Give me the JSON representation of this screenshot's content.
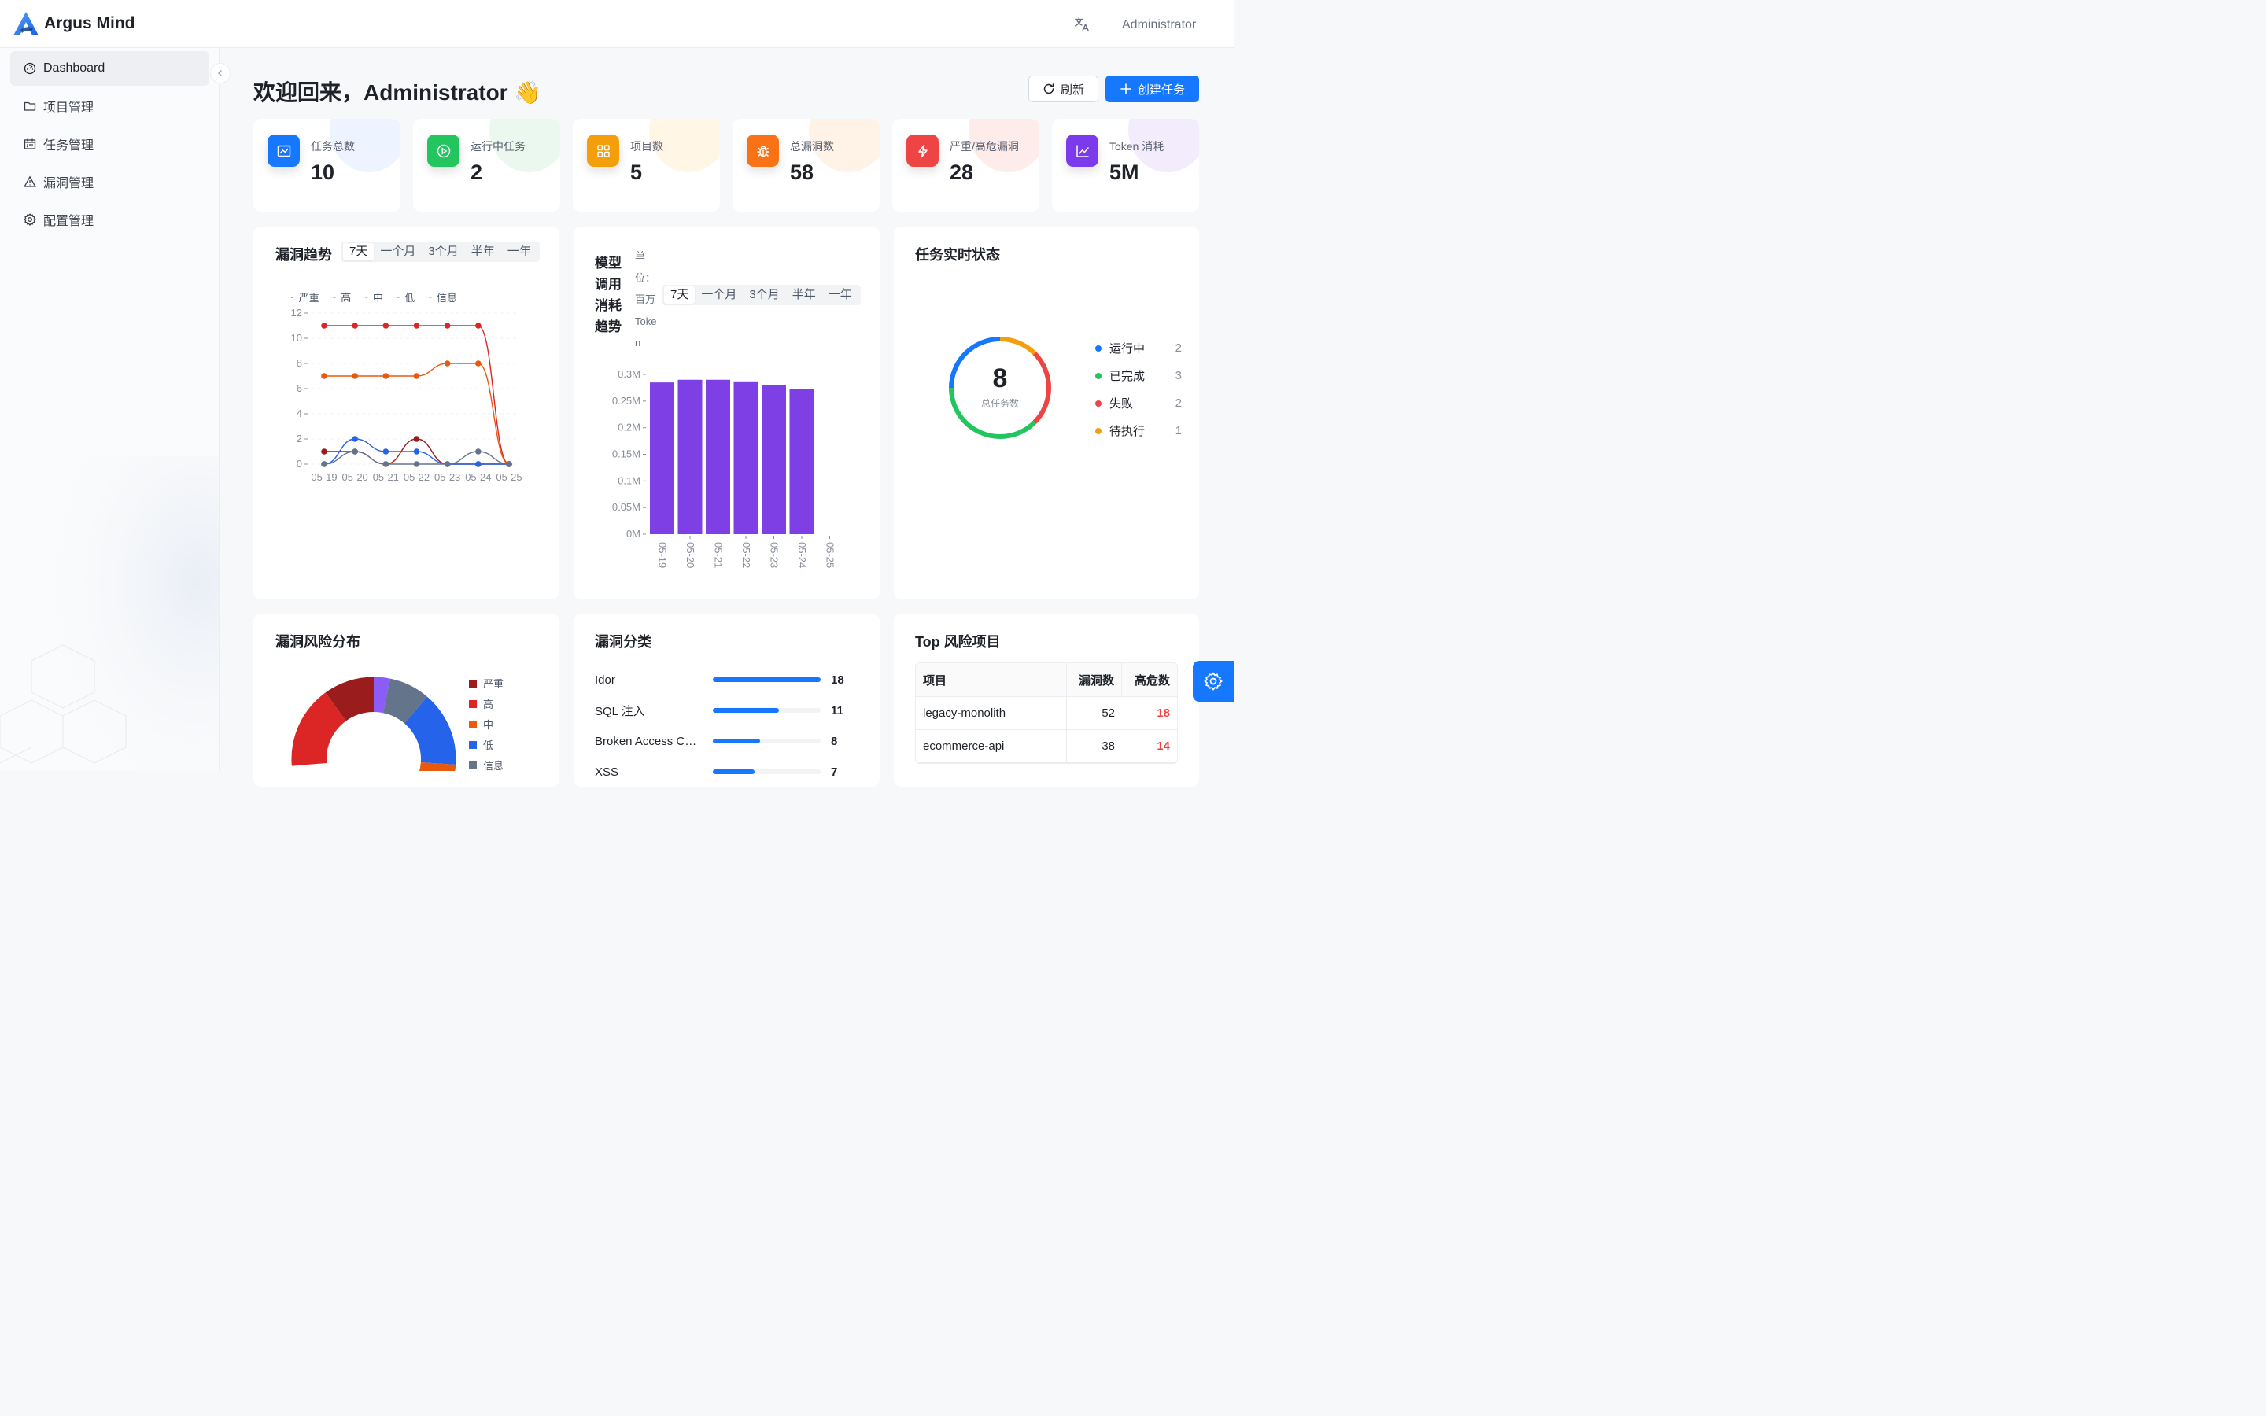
{
  "brand": {
    "name": "Argus Mind",
    "logo_icon": "argus-a-logo"
  },
  "header": {
    "user": "Administrator",
    "translate_icon": "translate-icon"
  },
  "sidebar": {
    "items": [
      {
        "label": "Dashboard",
        "icon": "dashboard-icon",
        "active": true
      },
      {
        "label": "项目管理",
        "icon": "folder-icon"
      },
      {
        "label": "任务管理",
        "icon": "calendar-icon"
      },
      {
        "label": "漏洞管理",
        "icon": "warning-icon"
      },
      {
        "label": "配置管理",
        "icon": "gear-icon"
      }
    ]
  },
  "welcome": {
    "title": "欢迎回来，Administrator 👋",
    "refresh_label": "刷新",
    "create_label": "创建任务"
  },
  "stats": [
    {
      "label": "任务总数",
      "value": "10",
      "color": "#1677ff"
    },
    {
      "label": "运行中任务",
      "value": "2",
      "color": "#22c55e"
    },
    {
      "label": "项目数",
      "value": "5",
      "color": "#f59e0b"
    },
    {
      "label": "总漏洞数",
      "value": "58",
      "color": "#f97316"
    },
    {
      "label": "严重/高危漏洞",
      "value": "28",
      "color": "#ef4444"
    },
    {
      "label": "Token 消耗",
      "value": "5M",
      "color": "#7c3aed"
    }
  ],
  "ranges": [
    "7天",
    "一个月",
    "3个月",
    "半年",
    "一年"
  ],
  "vuln_trend": {
    "title": "漏洞趋势",
    "chart_data": {
      "type": "line",
      "x": [
        "05-19",
        "05-20",
        "05-21",
        "05-22",
        "05-23",
        "05-24",
        "05-25"
      ],
      "ylim": [
        0,
        12
      ],
      "yticks": [
        "0",
        "2",
        "4",
        "6",
        "8",
        "10",
        "12"
      ],
      "series": [
        {
          "name": "严重",
          "color": "#9b1c1c",
          "values": [
            1,
            1,
            0,
            2,
            0,
            0,
            0
          ]
        },
        {
          "name": "高",
          "color": "#dc2626",
          "values": [
            11,
            11,
            11,
            11,
            11,
            11,
            0
          ]
        },
        {
          "name": "中",
          "color": "#ea580c",
          "values": [
            7,
            7,
            7,
            7,
            8,
            8,
            0
          ]
        },
        {
          "name": "低",
          "color": "#2563eb",
          "values": [
            0,
            2,
            1,
            1,
            0,
            0,
            0
          ]
        },
        {
          "name": "信息",
          "color": "#64748b",
          "values": [
            0,
            1,
            0,
            0,
            0,
            1,
            0
          ]
        }
      ]
    }
  },
  "token_trend": {
    "title": "模型调用消耗趋势",
    "unit_label": "单位：百万Token",
    "chart_data": {
      "type": "bar",
      "categories": [
        "05-19",
        "05-20",
        "05-21",
        "05-22",
        "05-23",
        "05-24",
        "05-25"
      ],
      "values": [
        0.285,
        0.29,
        0.29,
        0.287,
        0.28,
        0.272,
        0
      ],
      "ylim": [
        0,
        0.3
      ],
      "yticks": [
        "0M",
        "0.05M",
        "0.1M",
        "0.15M",
        "0.2M",
        "0.25M",
        "0.3M"
      ],
      "color": "#7e3fe4"
    }
  },
  "task_status": {
    "title": "任务实时状态",
    "total": "8",
    "total_label": "总任务数",
    "chart_data": {
      "type": "pie",
      "items": [
        {
          "label": "运行中",
          "value": 2,
          "color": "#1677ff"
        },
        {
          "label": "已完成",
          "value": 3,
          "color": "#22c55e"
        },
        {
          "label": "失败",
          "value": 2,
          "color": "#ef4444"
        },
        {
          "label": "待执行",
          "value": 1,
          "color": "#f59e0b"
        }
      ]
    }
  },
  "risk_dist": {
    "title": "漏洞风险分布",
    "legend": [
      {
        "label": "严重",
        "color": "#9b1c1c"
      },
      {
        "label": "高",
        "color": "#dc2626"
      },
      {
        "label": "中",
        "color": "#ea580c"
      },
      {
        "label": "低",
        "color": "#2563eb"
      },
      {
        "label": "信息",
        "color": "#64748b"
      }
    ]
  },
  "vuln_category": {
    "title": "漏洞分类",
    "items": [
      {
        "name": "Idor",
        "count": "18",
        "ratio": 1.0
      },
      {
        "name": "SQL 注入",
        "count": "11",
        "ratio": 0.61
      },
      {
        "name": "Broken Access Control",
        "count": "8",
        "ratio": 0.44
      },
      {
        "name": "XSS",
        "count": "7",
        "ratio": 0.39
      }
    ]
  },
  "top_risk": {
    "title": "Top 风险项目",
    "headers": [
      "项目",
      "漏洞数",
      "高危数"
    ],
    "rows": [
      {
        "name": "legacy-monolith",
        "vulns": "52",
        "high": "18"
      },
      {
        "name": "ecommerce-api",
        "vulns": "38",
        "high": "14"
      }
    ]
  }
}
